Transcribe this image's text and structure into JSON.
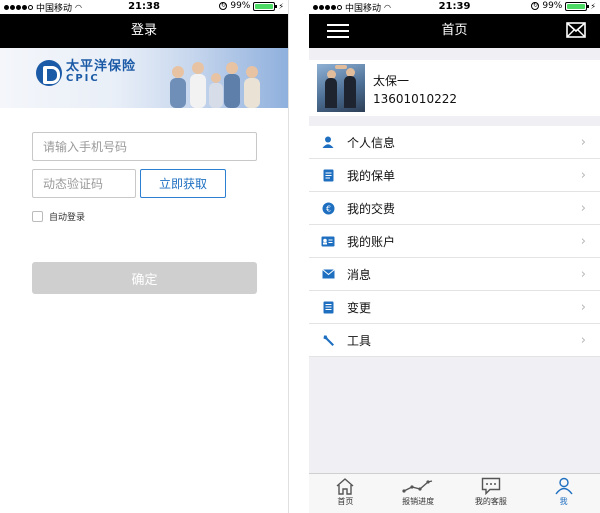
{
  "left": {
    "status": {
      "carrier": "中国移动",
      "time": "21:38",
      "battery": "99%",
      "battery_level": 0.99
    },
    "nav": {
      "title": "登录"
    },
    "banner": {
      "brand_cn": "太平洋保险",
      "brand_en": "CPIC"
    },
    "form": {
      "phone_placeholder": "请输入手机号码",
      "code_placeholder": "动态验证码",
      "get_code": "立即获取",
      "auto_login": "自动登录",
      "confirm": "确定"
    }
  },
  "right": {
    "status": {
      "carrier": "中国移动",
      "time": "21:39",
      "battery": "99%",
      "battery_level": 0.99
    },
    "nav": {
      "title": "首页",
      "menu_icon": "hamburger-menu-icon",
      "mail_icon": "mail-icon"
    },
    "profile": {
      "name": "太保一",
      "phone": "13601010222"
    },
    "menu": [
      {
        "label": "个人信息",
        "icon": "person-icon"
      },
      {
        "label": "我的保单",
        "icon": "policy-document-icon"
      },
      {
        "label": "我的交费",
        "icon": "payment-icon"
      },
      {
        "label": "我的账户",
        "icon": "account-card-icon"
      },
      {
        "label": "消息",
        "icon": "message-envelope-icon"
      },
      {
        "label": "变更",
        "icon": "change-document-icon"
      },
      {
        "label": "工具",
        "icon": "wrench-tool-icon"
      }
    ],
    "tabs": [
      {
        "label": "首页",
        "icon": "home-icon",
        "active": false
      },
      {
        "label": "报销进度",
        "icon": "progress-chart-icon",
        "active": false
      },
      {
        "label": "我的客服",
        "icon": "chat-bubble-icon",
        "active": false
      },
      {
        "label": "我",
        "icon": "user-profile-icon",
        "active": true
      }
    ]
  },
  "colors": {
    "accent": "#1f6fc1",
    "navbar": "#000000",
    "disabled_button": "#cfcfcf",
    "battery": "#4cd964"
  }
}
